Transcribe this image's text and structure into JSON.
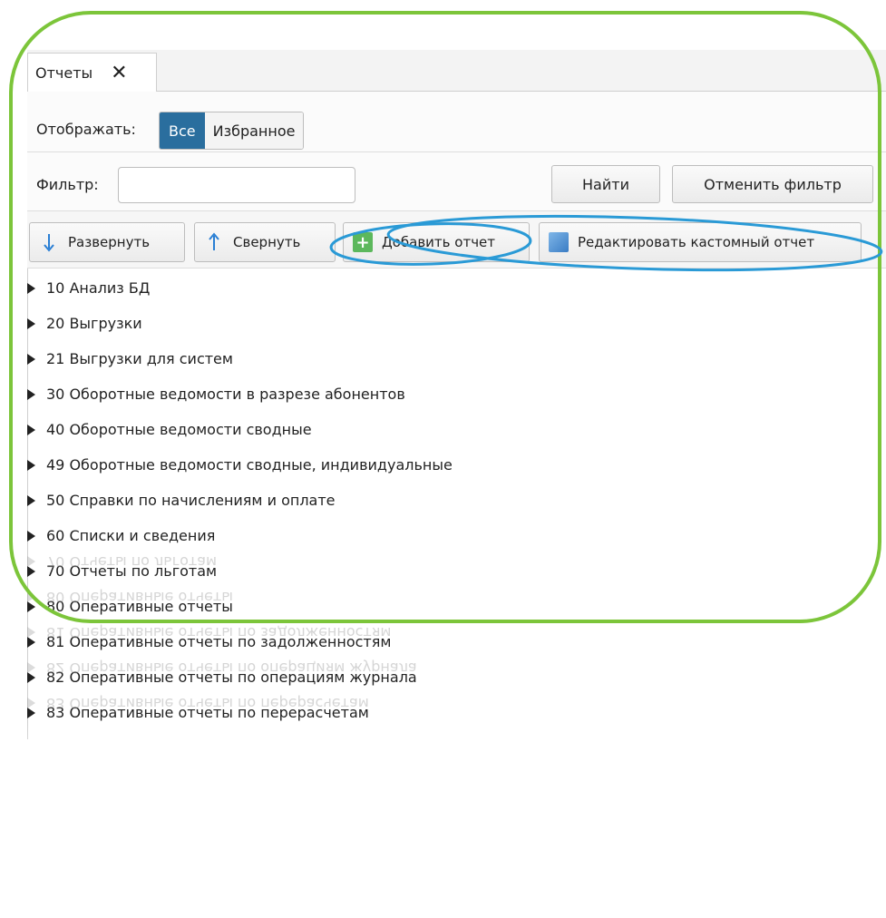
{
  "tab": {
    "title": "Отчеты"
  },
  "display": {
    "label": "Отображать:",
    "options": [
      "Все",
      "Избранное"
    ],
    "active": "Все"
  },
  "filter": {
    "label": "Фильтр:",
    "value": "",
    "find_label": "Найти",
    "cancel_label": "Отменить фильтр"
  },
  "toolbar": {
    "expand_label": "Развернуть",
    "collapse_label": "Свернуть",
    "add_label": "Добавить отчет",
    "edit_label": "Редактировать кастомный отчет"
  },
  "tree": [
    "10 Анализ БД",
    "20 Выгрузки",
    "21 Выгрузки для систем",
    "30 Оборотные ведомости в разрезе абонентов",
    "40 Оборотные ведомости сводные",
    "49 Оборотные ведомости сводные, индивидуальные",
    "50 Справки по начислениям и оплате",
    "60 Списки и сведения",
    "70 Отчеты по льготам",
    "80 Оперативные отчеты",
    "81 Оперативные отчеты по задолженностям",
    "82 Оперативные отчеты по операциям журнала",
    "83 Оперативные отчеты по перерасчетам"
  ],
  "colors": {
    "frame": "#7cc53a",
    "annotation": "#2a9ad6",
    "active": "#2a6e9e"
  }
}
